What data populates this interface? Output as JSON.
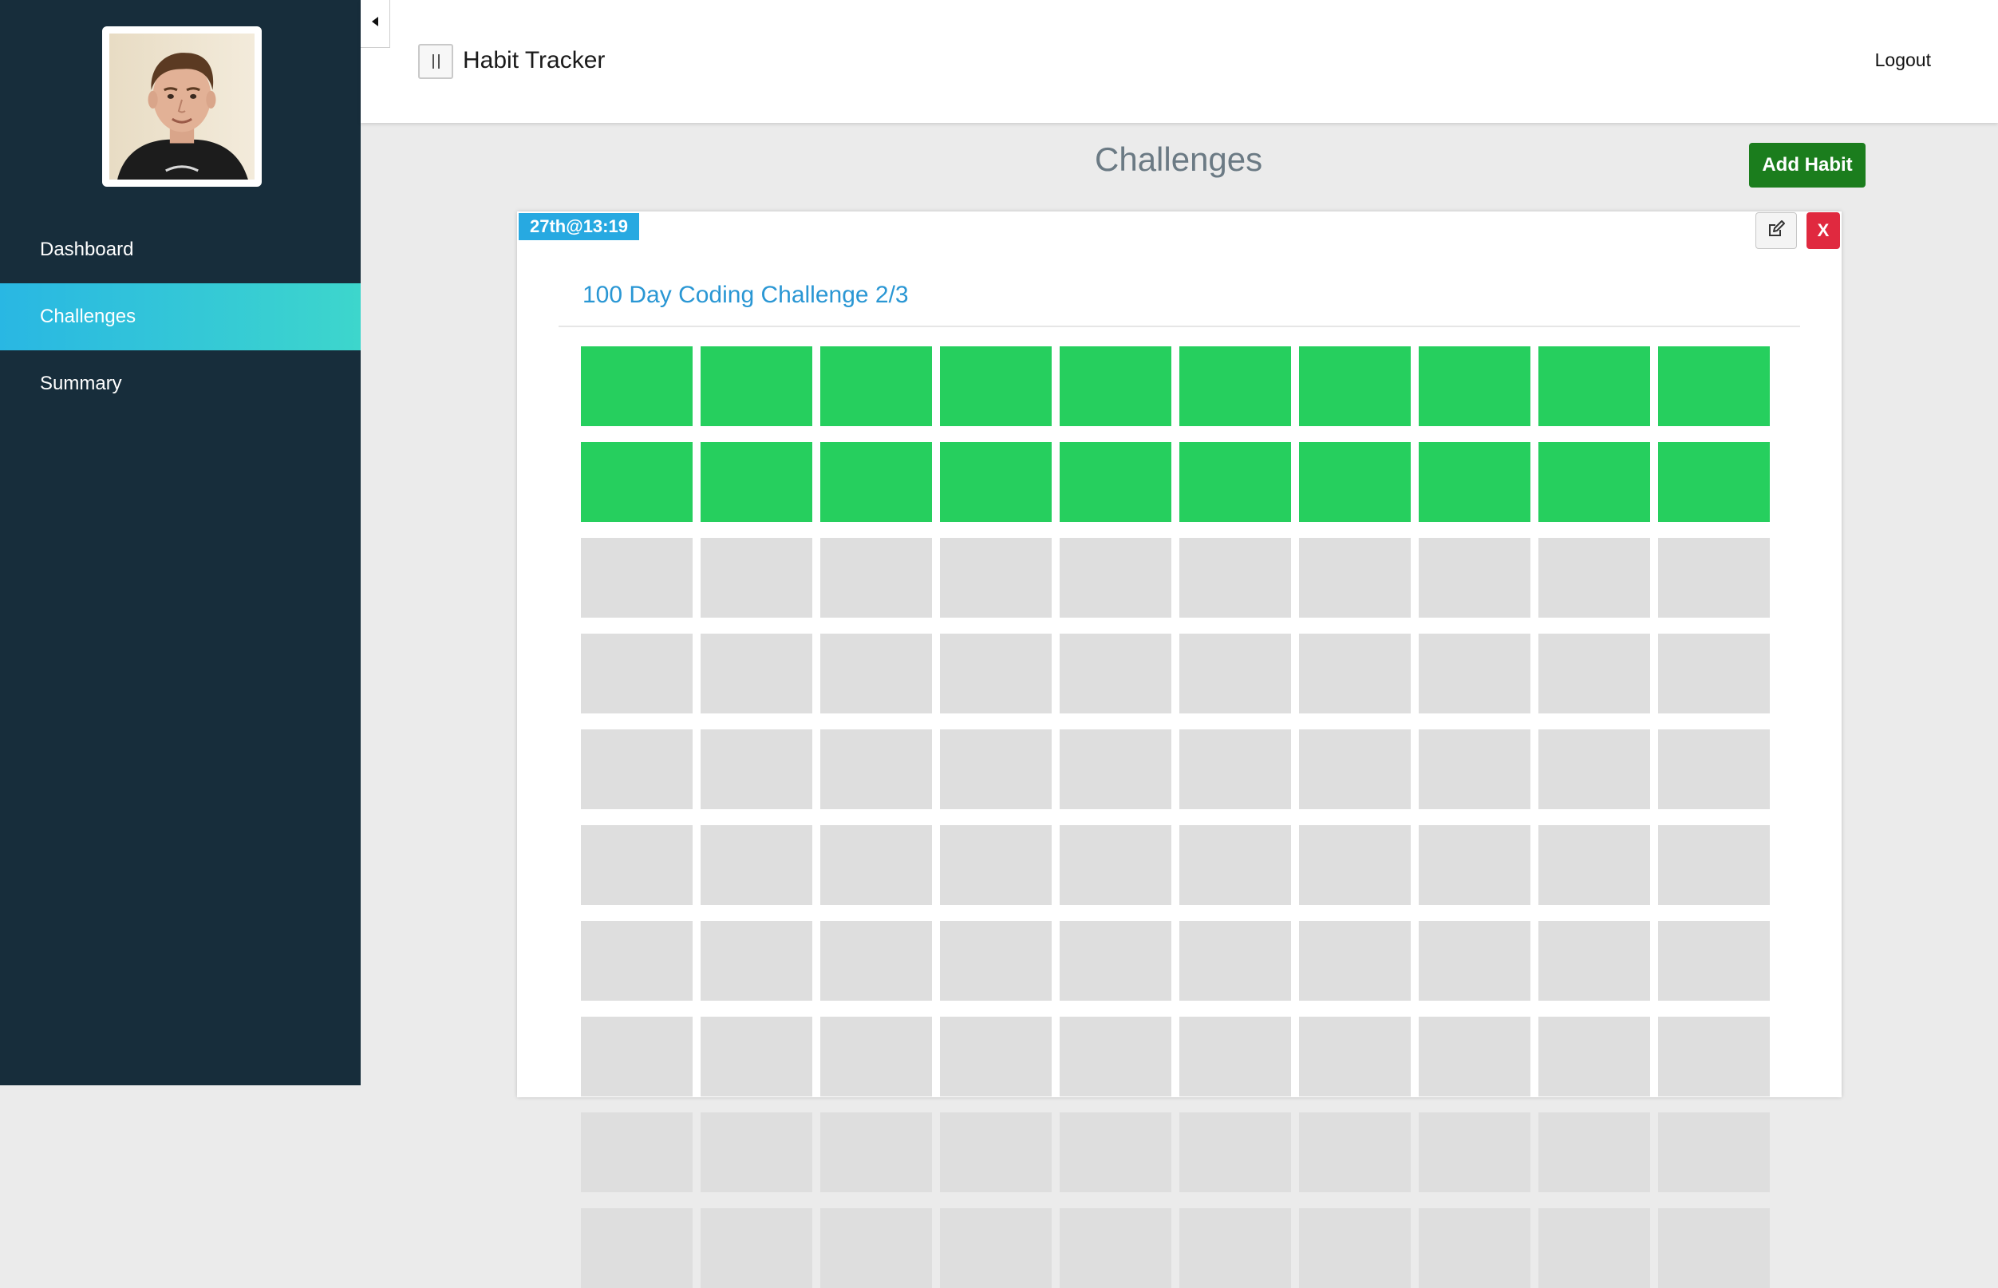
{
  "app": {
    "title": "Habit Tracker",
    "logout_label": "Logout"
  },
  "sidebar": {
    "items": [
      {
        "label": "Dashboard",
        "active": false
      },
      {
        "label": "Challenges",
        "active": true
      },
      {
        "label": "Summary",
        "active": false
      }
    ]
  },
  "main": {
    "page_title": "Challenges",
    "add_habit_label": "Add Habit"
  },
  "habit": {
    "timestamp": "27th@13:19",
    "title": "100 Day Coding Challenge 2/3",
    "delete_label": "X",
    "total_days": 100,
    "completed_days": 20
  },
  "colors": {
    "sidebar_bg": "#172d3b",
    "active_gradient_start": "#29b7e3",
    "active_gradient_end": "#3dd6cc",
    "add_habit_bg": "#1b7d1d",
    "timestamp_bg": "#27a9e1",
    "delete_bg": "#e0293f",
    "day_done": "#26cf5e",
    "day_pending": "#dedede"
  },
  "icons": {
    "collapse": "caret-left-icon",
    "menu_toggle": "pause-icon",
    "edit": "edit-icon"
  }
}
